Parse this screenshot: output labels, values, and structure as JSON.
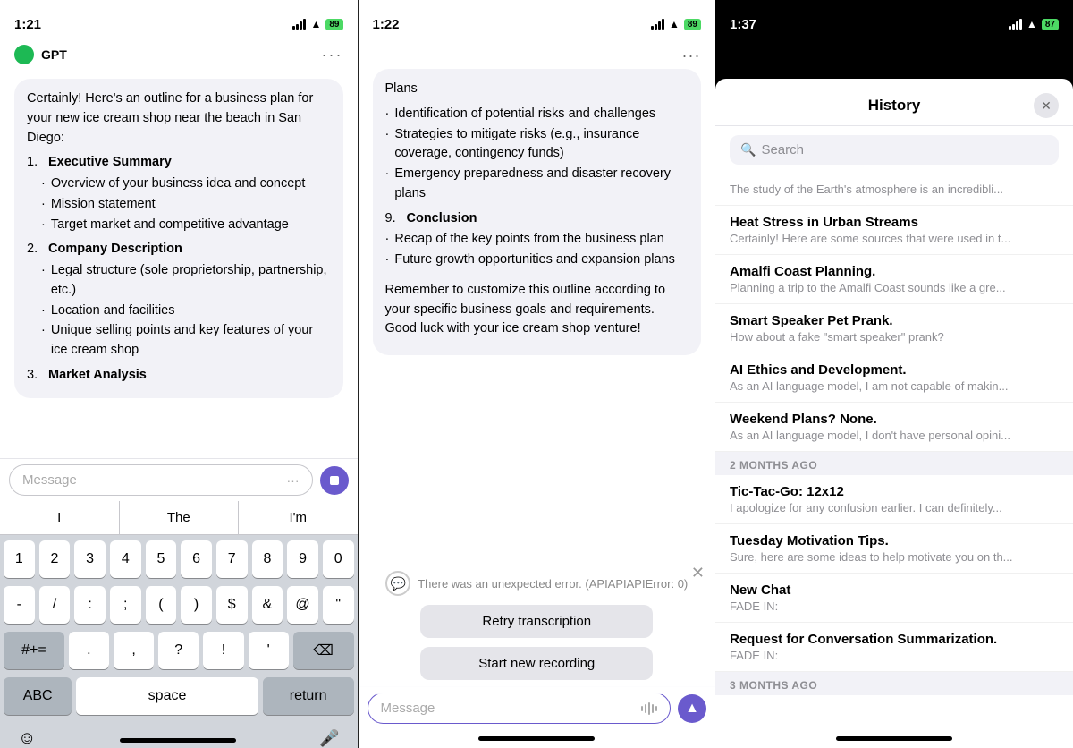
{
  "panel1": {
    "status": {
      "time": "1:21",
      "battery": "89"
    },
    "sender": "GPT",
    "message_intro": "Certainly! Here's an outline for a business plan for your new ice cream shop near the beach in San Diego:",
    "outline": [
      {
        "num": "1.",
        "title": "Executive Summary",
        "items": [
          "Overview of your business idea and concept",
          "Mission statement",
          "Target market and competitive advantage"
        ]
      },
      {
        "num": "2.",
        "title": "Company Description",
        "items": [
          "Legal structure (sole proprietorship, partnership, etc.)",
          "Location and facilities",
          "Unique selling points and key features of your ice cream shop"
        ]
      },
      {
        "num": "3.",
        "title": "Market Analysis",
        "items": []
      }
    ],
    "message_input_placeholder": "Message",
    "suggestions": [
      "I",
      "The",
      "I'm"
    ],
    "keyboard_rows": [
      [
        "1",
        "2",
        "3",
        "4",
        "5",
        "6",
        "7",
        "8",
        "9",
        "0"
      ],
      [
        "-",
        "/",
        ":",
        ";",
        "(",
        ")",
        "$",
        "&",
        "@",
        "\""
      ],
      [
        "#+=",
        ".",
        ",",
        "?",
        "!",
        "'",
        "⌫"
      ],
      [
        "ABC",
        "space",
        "return"
      ]
    ]
  },
  "panel2": {
    "status": {
      "time": "1:22",
      "battery": "89"
    },
    "dots_label": "...",
    "content_top": "Plans",
    "risk_items": [
      "Identification of potential risks and challenges",
      "Strategies to mitigate risks (e.g., insurance coverage, contingency funds)",
      "Emergency preparedness and disaster recovery plans"
    ],
    "conclusion_num": "9.",
    "conclusion_title": "Conclusion",
    "conclusion_items": [
      "Recap of the key points from the business plan",
      "Future growth opportunities and expansion plans"
    ],
    "closing_text": "Remember to customize this outline according to your specific business goals and requirements. Good luck with your ice cream shop venture!",
    "message_input_placeholder": "Message",
    "error_message": "There was an unexpected error. (APIAPIAPIError: 0)",
    "retry_btn": "Retry transcription",
    "new_recording_btn": "Start new recording"
  },
  "panel3": {
    "status": {
      "time": "1:37",
      "battery": "87"
    },
    "modal_title": "History",
    "search_placeholder": "Search",
    "partial_preview": "The study of the Earth's atmosphere is an incredibli...",
    "items_recent": [
      {
        "title": "Heat Stress in Urban Streams",
        "preview": "Certainly! Here are some sources that were used in t..."
      },
      {
        "title": "Amalfi Coast Planning.",
        "preview": "Planning a trip to the Amalfi Coast sounds like a gre..."
      },
      {
        "title": "Smart Speaker Pet Prank.",
        "preview": "How about a fake \"smart speaker\" prank?"
      },
      {
        "title": "AI Ethics and Development.",
        "preview": "As an AI language model, I am not capable of makin..."
      },
      {
        "title": "Weekend Plans? None.",
        "preview": "As an AI language model, I don't have personal opini..."
      }
    ],
    "section_2months": "2 MONTHS AGO",
    "items_2months": [
      {
        "title": "Tic-Tac-Go: 12x12",
        "preview": "I apologize for any confusion earlier. I can definitely..."
      },
      {
        "title": "Tuesday Motivation Tips.",
        "preview": "Sure, here are some ideas to help motivate you on th..."
      },
      {
        "title": "New Chat",
        "preview": "FADE IN:"
      },
      {
        "title": "Request for Conversation Summarization.",
        "preview": "FADE IN:"
      }
    ],
    "section_3months": "3 MONTHS AGO"
  }
}
